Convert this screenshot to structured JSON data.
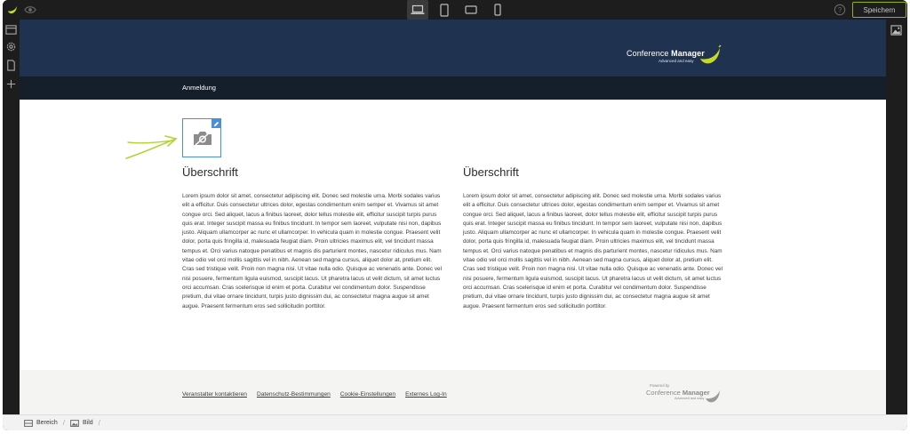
{
  "toolbar": {
    "save_label": "Speichern",
    "devices": [
      "laptop-icon",
      "tablet-portrait-icon",
      "tablet-landscape-icon",
      "phone-icon"
    ],
    "active_device": "laptop-icon"
  },
  "site": {
    "brand": {
      "name_regular": "Conference",
      "name_bold": "Manager",
      "tagline": "Advanced and easy"
    },
    "nav": {
      "item": "Anmeldung"
    },
    "columns": [
      {
        "title": "Überschrift",
        "text": "Lorem ipsum dolor sit amet, consectetur adipiscing elit. Donec sed molestie urna. Morbi sodales varius elit a efficitur. Duis consectetur ultrices dolor, egestas condimentum enim semper et. Vivamus sit amet congue orci. Sed aliquet, lacus a finibus laoreet, dolor tellus molestie elit, efficitur suscipit turpis purus quis erat. Integer suscipit massa eu finibus tincidunt. In tempor sem laoreet, vulputate nisi non, dapibus justo. Aliquam ullamcorper ac nunc et ullamcorper. In vehicula quam in molestie congue. Praesent velit dolor, porta quis fringilla id, malesuada feugiat diam. Proin ultricies maximus elit, vel tincidunt massa tempus et. Orci varius natoque penatibus et magnis dis parturient montes, nascetur ridiculus mus. Nam vitae odio vel orci mollis sagittis vel in nibh. Aenean sed magna cursus, aliquet dolor at, pretium elit. Cras sed tristique velit. Proin non magna nisi. Ut vitae nulla odio. Quisque ac venenatis ante. Donec vel nisi posuere, fermentum ligula euismod, suscipit lacus. Ut pharetra lacus ut velit dictum, sit amet luctus orci accumsan. Cras scelerisque id enim et porta. Curabitur vel condimentum dolor. Suspendisse pretium, dui vitae ornare tincidunt, turpis justo dignissim dui, ac consectetur magna augue sit amet augue. Praesent fermentum eros sed sollicitudin porttitor."
      },
      {
        "title": "Überschrift",
        "text": "Lorem ipsum dolor sit amet, consectetur adipiscing elit. Donec sed molestie urna. Morbi sodales varius elit a efficitur. Duis consectetur ultrices dolor, egestas condimentum enim semper et. Vivamus sit amet congue orci. Sed aliquet, lacus a finibus laoreet, dolor tellus molestie elit, efficitur suscipit turpis purus quis erat. Integer suscipit massa eu finibus tincidunt. In tempor sem laoreet, vulputate nisi non, dapibus justo. Aliquam ullamcorper ac nunc et ullamcorper. In vehicula quam in molestie congue. Praesent velit dolor, porta quis fringilla id, malesuada feugiat diam. Proin ultricies maximus elit, vel tincidunt massa tempus et. Orci varius natoque penatibus et magnis dis parturient montes, nascetur ridiculus mus. Nam vitae odio vel orci mollis sagittis vel in nibh. Aenean sed magna cursus, aliquet dolor at, pretium elit. Cras sed tristique velit. Proin non magna nisi. Ut vitae nulla odio. Quisque ac venenatis ante. Donec vel nisi posuere, fermentum ligula euismod, suscipit lacus. Ut pharetra lacus ut velit dictum, sit amet luctus orci accumsan. Cras scelerisque id enim et porta. Curabitur vel condimentum dolor. Suspendisse pretium, dui vitae ornare tincidunt, turpis justo dignissim dui, ac consectetur magna augue sit amet augue. Praesent fermentum eros sed sollicitudin porttitor."
      }
    ],
    "footer": {
      "links": [
        "Veranstalter kontaktieren",
        "Datenschutz-Bestimmungen",
        "Cookie-Einstellungen",
        "Externes Log-In"
      ],
      "powered_label": "Powered by",
      "powered_name_regular": "Conference",
      "powered_name_bold": "Manager",
      "powered_tagline": "Advanced and easy"
    }
  },
  "breadcrumb": [
    {
      "label": "Bereich",
      "icon": "section-icon"
    },
    {
      "label": "Bild",
      "icon": "image-icon"
    }
  ],
  "colors": {
    "header_bg": "#1f3350",
    "nav_bg": "#141f2b",
    "accent_green": "#c6d82a",
    "selection_blue": "#4a90d9",
    "chrome_dark": "#1d1d1d"
  }
}
